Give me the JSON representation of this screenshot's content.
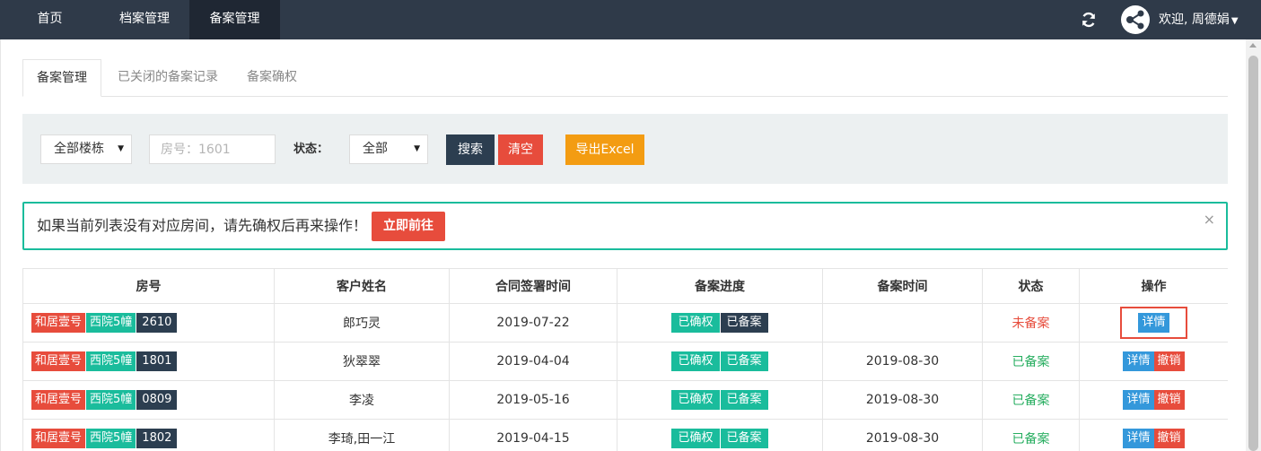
{
  "nav": {
    "items": [
      {
        "label": "首页"
      },
      {
        "label": "档案管理"
      },
      {
        "label": "备案管理"
      }
    ],
    "user_greeting": "欢迎, 周德娟"
  },
  "tabs": [
    {
      "label": "备案管理"
    },
    {
      "label": "已关闭的备案记录"
    },
    {
      "label": "备案确权"
    }
  ],
  "filter": {
    "building_select": "全部楼栋",
    "room_placeholder": "房号：1601",
    "status_label": "状态：",
    "status_select": "全部",
    "search_button": "搜索",
    "clear_button": "清空",
    "export_button": "导出Excel"
  },
  "alert": {
    "text": "如果当前列表没有对应房间，请先确权后再来操作！",
    "action_button": "立即前往",
    "close": "×"
  },
  "table": {
    "headers": [
      "房号",
      "客户姓名",
      "合同签署时间",
      "备案进度",
      "备案时间",
      "状态",
      "操作"
    ],
    "rows": [
      {
        "project": "和居壹号",
        "building": "西院5幢",
        "room": "2610",
        "customer": "郎巧灵",
        "sign_date": "2019-07-22",
        "progress": [
          "已确权",
          "已备案"
        ],
        "filing_date": "",
        "status": "未备案",
        "ops": [
          "详情"
        ]
      },
      {
        "project": "和居壹号",
        "building": "西院5幢",
        "room": "1801",
        "customer": "狄翠翠",
        "sign_date": "2019-04-04",
        "progress": [
          "已确权",
          "已备案"
        ],
        "filing_date": "2019-08-30",
        "status": "已备案",
        "ops": [
          "详情",
          "撤销"
        ]
      },
      {
        "project": "和居壹号",
        "building": "西院5幢",
        "room": "0809",
        "customer": "李凌",
        "sign_date": "2019-05-16",
        "progress": [
          "已确权",
          "已备案"
        ],
        "filing_date": "2019-08-30",
        "status": "已备案",
        "ops": [
          "详情",
          "撤销"
        ]
      },
      {
        "project": "和居壹号",
        "building": "西院5幢",
        "room": "1802",
        "customer": "李琦,田一江",
        "sign_date": "2019-04-15",
        "progress": [
          "已确权",
          "已备案"
        ],
        "filing_date": "2019-08-30",
        "status": "已备案",
        "ops": [
          "详情",
          "撤销"
        ]
      }
    ]
  },
  "colors": {
    "nav_bg": "#2f3a49",
    "accent_green": "#1abc9c",
    "danger_red": "#e74c3c",
    "dark": "#2c3e50",
    "info_blue": "#3498db",
    "warning_orange": "#f39c12"
  },
  "icons": [
    "refresh-icon",
    "avatar-share-icon",
    "caret-down-icon",
    "close-icon"
  ]
}
